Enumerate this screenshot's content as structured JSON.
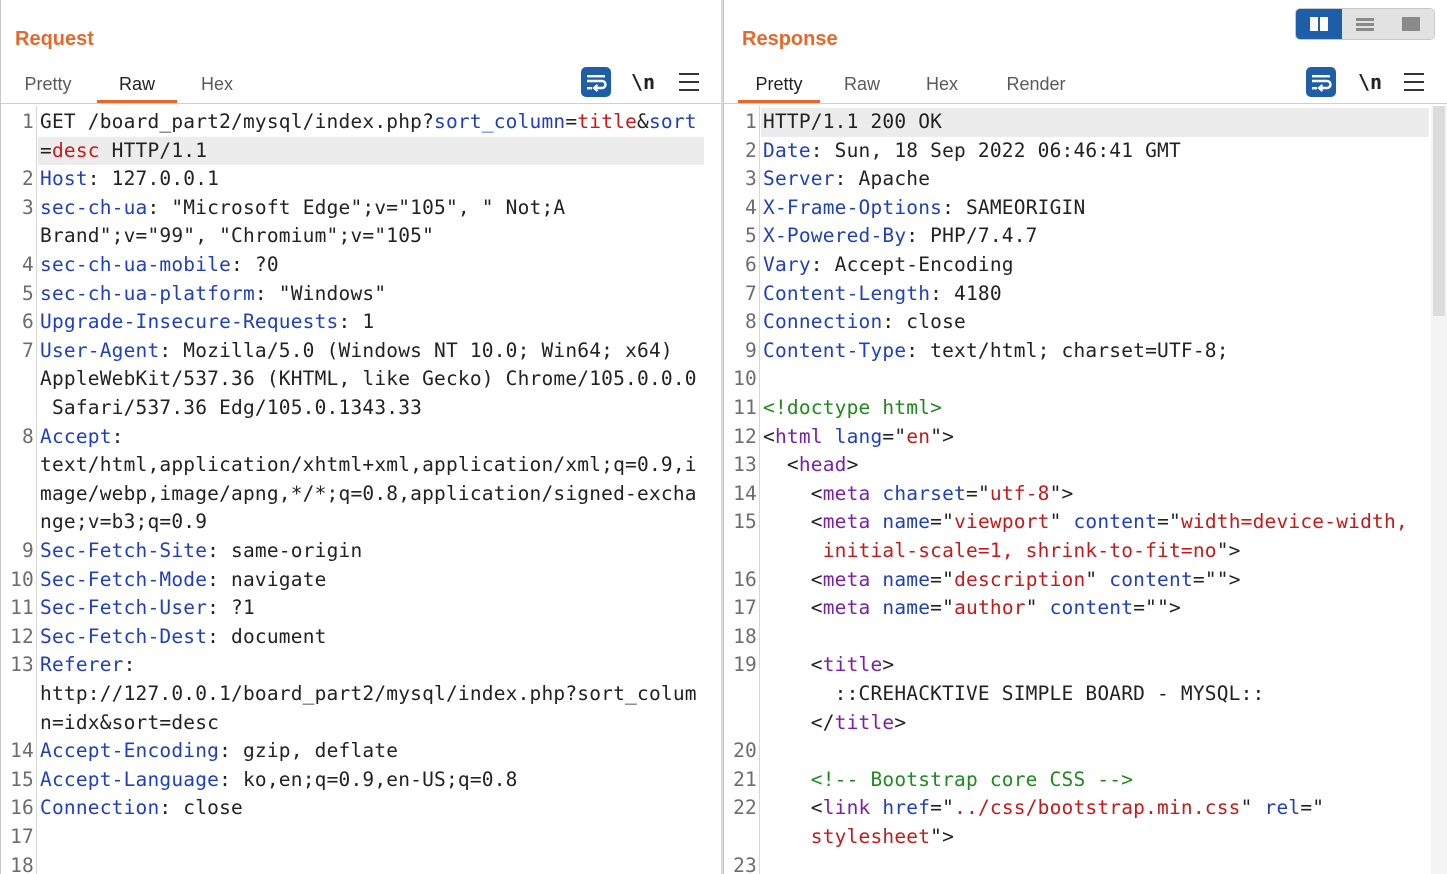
{
  "request": {
    "title": "Request",
    "tabs": [
      "Pretty",
      "Raw",
      "Hex"
    ],
    "active_tab": "Raw",
    "newline_label": "\\n"
  },
  "response": {
    "title": "Response",
    "tabs": [
      "Pretty",
      "Raw",
      "Hex",
      "Render"
    ],
    "active_tab": "Pretty",
    "newline_label": "\\n"
  },
  "colors": {
    "accent": "#e8672a",
    "button": "#1e5da8",
    "key": "#1f3fbf",
    "string": "#c41a1a",
    "comment": "#1c8a1c",
    "tag": "#7a1fa8"
  },
  "request_lines": [
    {
      "n": "1",
      "parts": [
        [
          "v",
          "GET /board_part2/mysql/index.php?"
        ],
        [
          "k",
          "sort_column"
        ],
        [
          "v",
          "="
        ],
        [
          "red",
          "title"
        ],
        [
          "v",
          "&"
        ],
        [
          "k",
          "sort"
        ]
      ]
    },
    {
      "n": "",
      "parts": [
        [
          "v",
          "="
        ],
        [
          "red",
          "desc"
        ],
        [
          "v",
          " HTTP/1.1"
        ]
      ],
      "highlight": true
    },
    {
      "n": "2",
      "parts": [
        [
          "k",
          "Host"
        ],
        [
          "v",
          ": 127.0.0.1"
        ]
      ]
    },
    {
      "n": "3",
      "parts": [
        [
          "k",
          "sec-ch-ua"
        ],
        [
          "v",
          ": \"Microsoft Edge\";v=\"105\", \" Not;A"
        ]
      ]
    },
    {
      "n": "",
      "parts": [
        [
          "v",
          "Brand\";v=\"99\", \"Chromium\";v=\"105\""
        ]
      ]
    },
    {
      "n": "4",
      "parts": [
        [
          "k",
          "sec-ch-ua-mobile"
        ],
        [
          "v",
          ": ?0"
        ]
      ]
    },
    {
      "n": "5",
      "parts": [
        [
          "k",
          "sec-ch-ua-platform"
        ],
        [
          "v",
          ": \"Windows\""
        ]
      ]
    },
    {
      "n": "6",
      "parts": [
        [
          "k",
          "Upgrade-Insecure-Requests"
        ],
        [
          "v",
          ": 1"
        ]
      ]
    },
    {
      "n": "7",
      "parts": [
        [
          "k",
          "User-Agent"
        ],
        [
          "v",
          ": Mozilla/5.0 (Windows NT 10.0; Win64; x64)"
        ]
      ]
    },
    {
      "n": "",
      "parts": [
        [
          "v",
          "AppleWebKit/537.36 (KHTML, like Gecko) Chrome/105.0.0.0"
        ]
      ]
    },
    {
      "n": "",
      "parts": [
        [
          "v",
          " Safari/537.36 Edg/105.0.1343.33"
        ]
      ]
    },
    {
      "n": "8",
      "parts": [
        [
          "k",
          "Accept"
        ],
        [
          "v",
          ":"
        ]
      ]
    },
    {
      "n": "",
      "parts": [
        [
          "v",
          "text/html,application/xhtml+xml,application/xml;q=0.9,i"
        ]
      ]
    },
    {
      "n": "",
      "parts": [
        [
          "v",
          "mage/webp,image/apng,*/*;q=0.8,application/signed-excha"
        ]
      ]
    },
    {
      "n": "",
      "parts": [
        [
          "v",
          "nge;v=b3;q=0.9"
        ]
      ]
    },
    {
      "n": "9",
      "parts": [
        [
          "k",
          "Sec-Fetch-Site"
        ],
        [
          "v",
          ": same-origin"
        ]
      ]
    },
    {
      "n": "10",
      "parts": [
        [
          "k",
          "Sec-Fetch-Mode"
        ],
        [
          "v",
          ": navigate"
        ]
      ]
    },
    {
      "n": "11",
      "parts": [
        [
          "k",
          "Sec-Fetch-User"
        ],
        [
          "v",
          ": ?1"
        ]
      ]
    },
    {
      "n": "12",
      "parts": [
        [
          "k",
          "Sec-Fetch-Dest"
        ],
        [
          "v",
          ": document"
        ]
      ]
    },
    {
      "n": "13",
      "parts": [
        [
          "k",
          "Referer"
        ],
        [
          "v",
          ":"
        ]
      ]
    },
    {
      "n": "",
      "parts": [
        [
          "v",
          "http://127.0.0.1/board_part2/mysql/index.php?sort_colum"
        ]
      ]
    },
    {
      "n": "",
      "parts": [
        [
          "v",
          "n=idx&sort=desc"
        ]
      ]
    },
    {
      "n": "14",
      "parts": [
        [
          "k",
          "Accept-Encoding"
        ],
        [
          "v",
          ": gzip, deflate"
        ]
      ]
    },
    {
      "n": "15",
      "parts": [
        [
          "k",
          "Accept-Language"
        ],
        [
          "v",
          ": ko,en;q=0.9,en-US;q=0.8"
        ]
      ]
    },
    {
      "n": "16",
      "parts": [
        [
          "k",
          "Connection"
        ],
        [
          "v",
          ": close"
        ]
      ]
    },
    {
      "n": "17",
      "parts": []
    },
    {
      "n": "18",
      "parts": []
    }
  ],
  "response_lines": [
    {
      "n": "1",
      "parts": [
        [
          "v",
          "HTTP/1.1 200 OK"
        ]
      ],
      "highlight": true
    },
    {
      "n": "2",
      "parts": [
        [
          "k",
          "Date"
        ],
        [
          "v",
          ": Sun, 18 Sep 2022 06:46:41 GMT"
        ]
      ]
    },
    {
      "n": "3",
      "parts": [
        [
          "k",
          "Server"
        ],
        [
          "v",
          ": Apache"
        ]
      ]
    },
    {
      "n": "4",
      "parts": [
        [
          "k",
          "X-Frame-Options"
        ],
        [
          "v",
          ": SAMEORIGIN"
        ]
      ]
    },
    {
      "n": "5",
      "parts": [
        [
          "k",
          "X-Powered-By"
        ],
        [
          "v",
          ": PHP/7.4.7"
        ]
      ]
    },
    {
      "n": "6",
      "parts": [
        [
          "k",
          "Vary"
        ],
        [
          "v",
          ": Accept-Encoding"
        ]
      ]
    },
    {
      "n": "7",
      "parts": [
        [
          "k",
          "Content-Length"
        ],
        [
          "v",
          ": 4180"
        ]
      ]
    },
    {
      "n": "8",
      "parts": [
        [
          "k",
          "Connection"
        ],
        [
          "v",
          ": close"
        ]
      ]
    },
    {
      "n": "9",
      "parts": [
        [
          "k",
          "Content-Type"
        ],
        [
          "v",
          ": text/html; charset=UTF-8;"
        ]
      ]
    },
    {
      "n": "10",
      "parts": []
    },
    {
      "n": "11",
      "parts": [
        [
          "grn",
          "<!doctype html>"
        ]
      ]
    },
    {
      "n": "12",
      "parts": [
        [
          "v",
          "<"
        ],
        [
          "tag",
          "html"
        ],
        [
          "attr",
          " lang"
        ],
        [
          "v",
          "=\""
        ],
        [
          "red",
          "en"
        ],
        [
          "v",
          "\">"
        ]
      ]
    },
    {
      "n": "13",
      "parts": [
        [
          "v",
          "  <"
        ],
        [
          "tag",
          "head"
        ],
        [
          "v",
          ">"
        ]
      ]
    },
    {
      "n": "14",
      "parts": [
        [
          "v",
          "    <"
        ],
        [
          "tag",
          "meta"
        ],
        [
          "attr",
          " charset"
        ],
        [
          "v",
          "=\""
        ],
        [
          "red",
          "utf-8"
        ],
        [
          "v",
          "\">"
        ]
      ]
    },
    {
      "n": "15",
      "parts": [
        [
          "v",
          "    <"
        ],
        [
          "tag",
          "meta"
        ],
        [
          "attr",
          " name"
        ],
        [
          "v",
          "=\""
        ],
        [
          "red",
          "viewport"
        ],
        [
          "v",
          "\""
        ],
        [
          "attr",
          " content"
        ],
        [
          "v",
          "=\""
        ],
        [
          "red",
          "width=device-width,"
        ]
      ]
    },
    {
      "n": "",
      "parts": [
        [
          "red",
          "     initial-scale=1, shrink-to-fit=no"
        ],
        [
          "v",
          "\">"
        ]
      ]
    },
    {
      "n": "16",
      "parts": [
        [
          "v",
          "    <"
        ],
        [
          "tag",
          "meta"
        ],
        [
          "attr",
          " name"
        ],
        [
          "v",
          "=\""
        ],
        [
          "red",
          "description"
        ],
        [
          "v",
          "\""
        ],
        [
          "attr",
          " content"
        ],
        [
          "v",
          "=\"\">"
        ]
      ]
    },
    {
      "n": "17",
      "parts": [
        [
          "v",
          "    <"
        ],
        [
          "tag",
          "meta"
        ],
        [
          "attr",
          " name"
        ],
        [
          "v",
          "=\""
        ],
        [
          "red",
          "author"
        ],
        [
          "v",
          "\""
        ],
        [
          "attr",
          " content"
        ],
        [
          "v",
          "=\"\">"
        ]
      ]
    },
    {
      "n": "18",
      "parts": []
    },
    {
      "n": "19",
      "parts": [
        [
          "v",
          "    <"
        ],
        [
          "tag",
          "title"
        ],
        [
          "v",
          ">"
        ]
      ]
    },
    {
      "n": "",
      "parts": [
        [
          "v",
          "      ::CREHACKTIVE SIMPLE BOARD - MYSQL::"
        ]
      ]
    },
    {
      "n": "",
      "parts": [
        [
          "v",
          "    </"
        ],
        [
          "tag",
          "title"
        ],
        [
          "v",
          ">"
        ]
      ]
    },
    {
      "n": "20",
      "parts": []
    },
    {
      "n": "21",
      "parts": [
        [
          "grn",
          "    <!-- Bootstrap core CSS -->"
        ]
      ]
    },
    {
      "n": "22",
      "parts": [
        [
          "v",
          "    <"
        ],
        [
          "tag",
          "link"
        ],
        [
          "attr",
          " href"
        ],
        [
          "v",
          "=\""
        ],
        [
          "red",
          "../css/bootstrap.min.css"
        ],
        [
          "v",
          "\""
        ],
        [
          "attr",
          " rel"
        ],
        [
          "v",
          "=\""
        ]
      ]
    },
    {
      "n": "",
      "parts": [
        [
          "red",
          "    stylesheet"
        ],
        [
          "v",
          "\">"
        ]
      ]
    },
    {
      "n": "23",
      "parts": []
    }
  ]
}
